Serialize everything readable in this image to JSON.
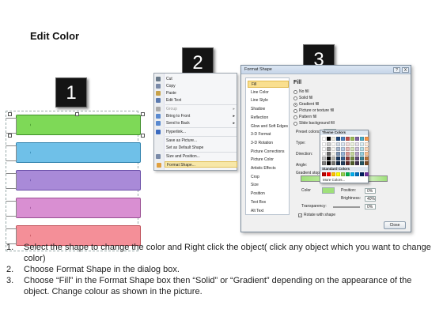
{
  "title": "Edit Color",
  "step_markers": [
    "1",
    "2",
    "3"
  ],
  "bands": [
    {
      "color": "#7ed957",
      "edge": "#3f8f2a"
    },
    {
      "color": "#6fc0e8",
      "edge": "#2f82ad"
    },
    {
      "color": "#a98ad8",
      "edge": "#6a4fa8"
    },
    {
      "color": "#d98fd2",
      "edge": "#9a4f93"
    },
    {
      "color": "#f48f98",
      "edge": "#bf4f58"
    }
  ],
  "context_menu": {
    "items": [
      {
        "label": "Cut",
        "icon": "scissors-icon",
        "icon_color": "#6a7a8a"
      },
      {
        "label": "Copy",
        "icon": "copy-icon",
        "icon_color": "#7a8aa8"
      },
      {
        "label": "Paste",
        "icon": "paste-icon",
        "icon_color": "#c8a24a"
      },
      {
        "label": "Edit Text",
        "icon": "edit-text-icon",
        "icon_color": "#5a7ab0"
      },
      {
        "label": "Group",
        "icon": "group-icon",
        "icon_color": "#aaaaaa",
        "submenu": true,
        "disabled": true
      },
      {
        "label": "Bring to Front",
        "icon": "bring-front-icon",
        "icon_color": "#5a8ad0",
        "submenu": true
      },
      {
        "label": "Send to Back",
        "icon": "send-back-icon",
        "icon_color": "#5a8ad0",
        "submenu": true
      },
      {
        "label": "Hyperlink...",
        "icon": "hyperlink-icon",
        "icon_color": "#3a6ac0"
      },
      {
        "label": "Save as Picture...",
        "icon": "",
        "icon_color": ""
      },
      {
        "label": "Set as Default Shape",
        "icon": "",
        "icon_color": ""
      },
      {
        "label": "Size and Position...",
        "icon": "size-icon",
        "icon_color": "#7a8aa8"
      },
      {
        "label": "Format Shape...",
        "icon": "format-shape-icon",
        "icon_color": "#e0a040",
        "selected": true
      }
    ]
  },
  "dialog": {
    "title": "Format Shape",
    "help_label": "?",
    "close_label": "X",
    "categories": [
      "Fill",
      "Line Color",
      "Line Style",
      "Shadow",
      "Reflection",
      "Glow and Soft Edges",
      "3-D Format",
      "3-D Rotation",
      "Picture Corrections",
      "Picture Color",
      "Artistic Effects",
      "Crop",
      "Size",
      "Position",
      "Text Box",
      "Alt Text"
    ],
    "selected_category": "Fill",
    "fill_header": "Fill",
    "fill_options": [
      "No fill",
      "Solid fill",
      "Gradient fill",
      "Picture or texture fill",
      "Pattern fill",
      "Slide background fill"
    ],
    "selected_fill": "Gradient fill",
    "props": {
      "preset_colors": "Preset colors:",
      "type": "Type:",
      "direction": "Direction:",
      "angle": "Angle:",
      "gradient_stops": "Gradient stops",
      "color": "Color",
      "position": "Position:",
      "position_value": "0%",
      "brightness": "Brightness:",
      "brightness_value": "40%",
      "transparency": "Transparency:",
      "transparency_value": "0%",
      "rotate_with_shape": "Rotate with shape",
      "rotate_checked": true
    },
    "close_button": "Close"
  },
  "color_popup": {
    "theme_header": "Theme Colors",
    "standard_header": "Standard Colors",
    "more_colors": "More Colors...",
    "theme_top": [
      "#ffffff",
      "#000000",
      "#eeece1",
      "#1f497d",
      "#4f81bd",
      "#c0504d",
      "#9bbb59",
      "#8064a2",
      "#4bacc6",
      "#f79646"
    ],
    "standard": [
      "#c00000",
      "#ff0000",
      "#ffc000",
      "#ffff00",
      "#92d050",
      "#00b050",
      "#00b0f0",
      "#0070c0",
      "#002060",
      "#7030a0"
    ]
  },
  "instructions": [
    {
      "num": "1.",
      "text": "Select the shape to change the color and Right click the object( click any object which you want to change color)"
    },
    {
      "num": "2.",
      "text": "Choose Format Shape in the dialog box."
    },
    {
      "num": "3.",
      "text": "Choose “Fill” in the Format Shape box then “Solid” or “Gradient” depending on the appearance of the object. Change colour as shown in the picture."
    }
  ]
}
